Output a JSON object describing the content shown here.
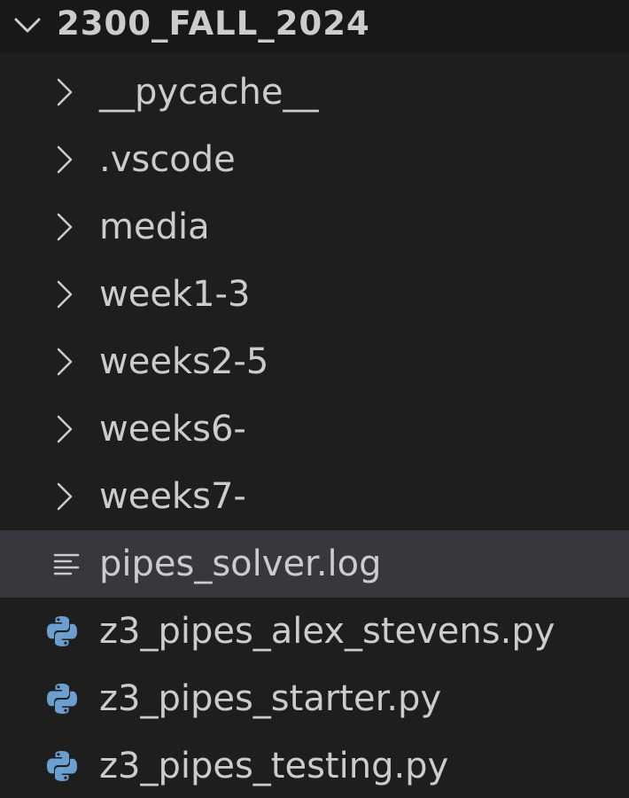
{
  "explorer": {
    "section_title": "2300_FALL_2024",
    "section_expanded": true,
    "items": [
      {
        "label": "__pycache__",
        "kind": "folder",
        "icon": "chevron-right-icon"
      },
      {
        "label": ".vscode",
        "kind": "folder",
        "icon": "chevron-right-icon"
      },
      {
        "label": "media",
        "kind": "folder",
        "icon": "chevron-right-icon"
      },
      {
        "label": "week1-3",
        "kind": "folder",
        "icon": "chevron-right-icon"
      },
      {
        "label": "weeks2-5",
        "kind": "folder",
        "icon": "chevron-right-icon"
      },
      {
        "label": "weeks6-",
        "kind": "folder",
        "icon": "chevron-right-icon"
      },
      {
        "label": "weeks7-",
        "kind": "folder",
        "icon": "chevron-right-icon"
      },
      {
        "label": "pipes_solver.log",
        "kind": "file",
        "icon": "log-file-icon",
        "selected": true
      },
      {
        "label": "z3_pipes_alex_stevens.py",
        "kind": "file",
        "icon": "python-icon"
      },
      {
        "label": "z3_pipes_starter.py",
        "kind": "file",
        "icon": "python-icon"
      },
      {
        "label": "z3_pipes_testing.py",
        "kind": "file",
        "icon": "python-icon"
      }
    ]
  },
  "colors": {
    "background": "#1e1e1e",
    "header_background": "#181818",
    "selected_row": "#37373d",
    "text": "#cccccc",
    "python_blue": "#6a9fcf"
  }
}
